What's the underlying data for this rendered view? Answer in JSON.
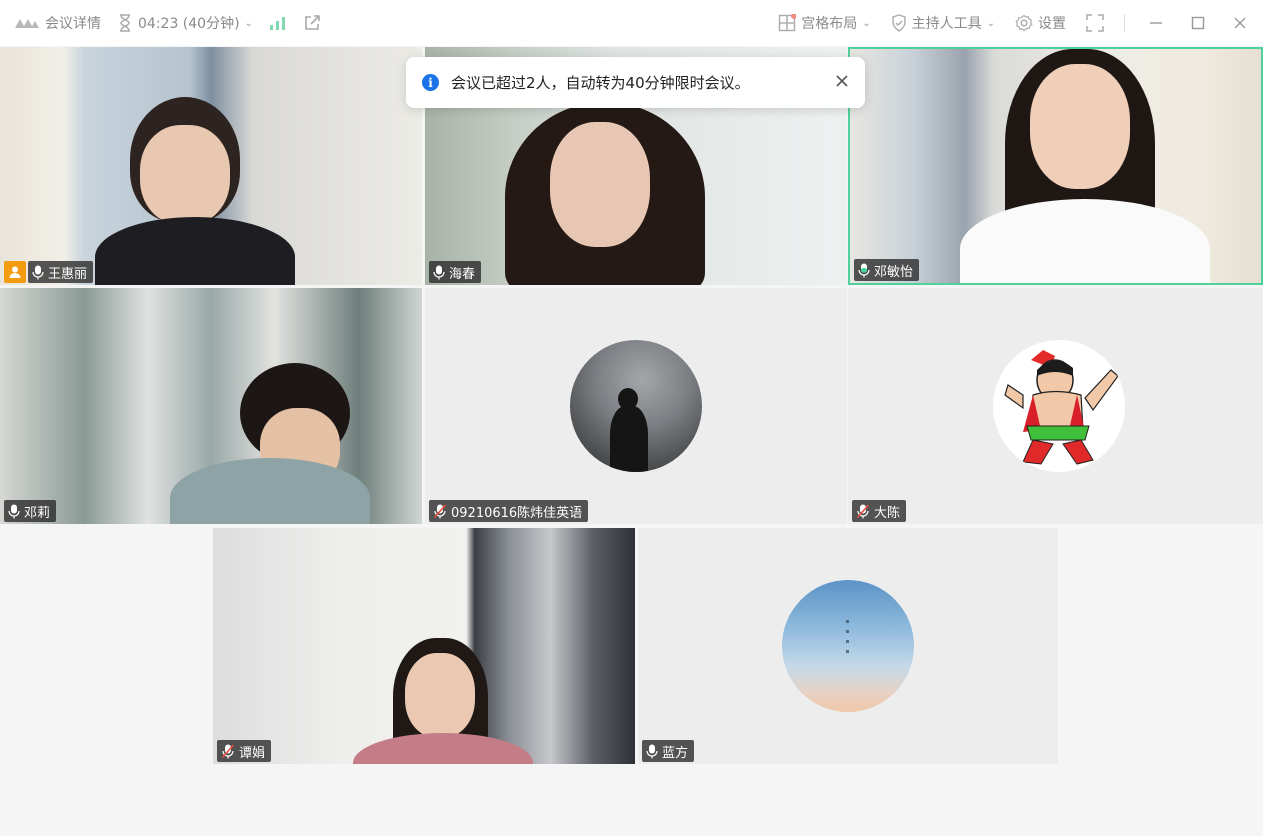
{
  "topbar": {
    "meeting_details": "会议详情",
    "timer": "04:23 (40分钟)",
    "layout": "宫格布局",
    "host_tools": "主持人工具",
    "settings": "设置"
  },
  "toast": {
    "message": "会议已超过2人，自动转为40分钟限时会议。"
  },
  "participants": [
    {
      "name": "王惠丽",
      "host": true,
      "mic": "on"
    },
    {
      "name": "海春",
      "mic": "on"
    },
    {
      "name": "邓敏怡",
      "mic": "speaking",
      "active": true
    },
    {
      "name": "邓莉",
      "mic": "on"
    },
    {
      "name": "09210616陈炜佳英语",
      "mic": "muted"
    },
    {
      "name": "大陈",
      "mic": "muted"
    },
    {
      "name": "谭娟",
      "mic": "muted"
    },
    {
      "name": "蓝方",
      "mic": "on"
    }
  ],
  "colors": {
    "active_border": "#4fd19b",
    "host_badge": "#f39c12",
    "info_blue": "#1a73e8",
    "muted_red": "#e74c3c"
  }
}
